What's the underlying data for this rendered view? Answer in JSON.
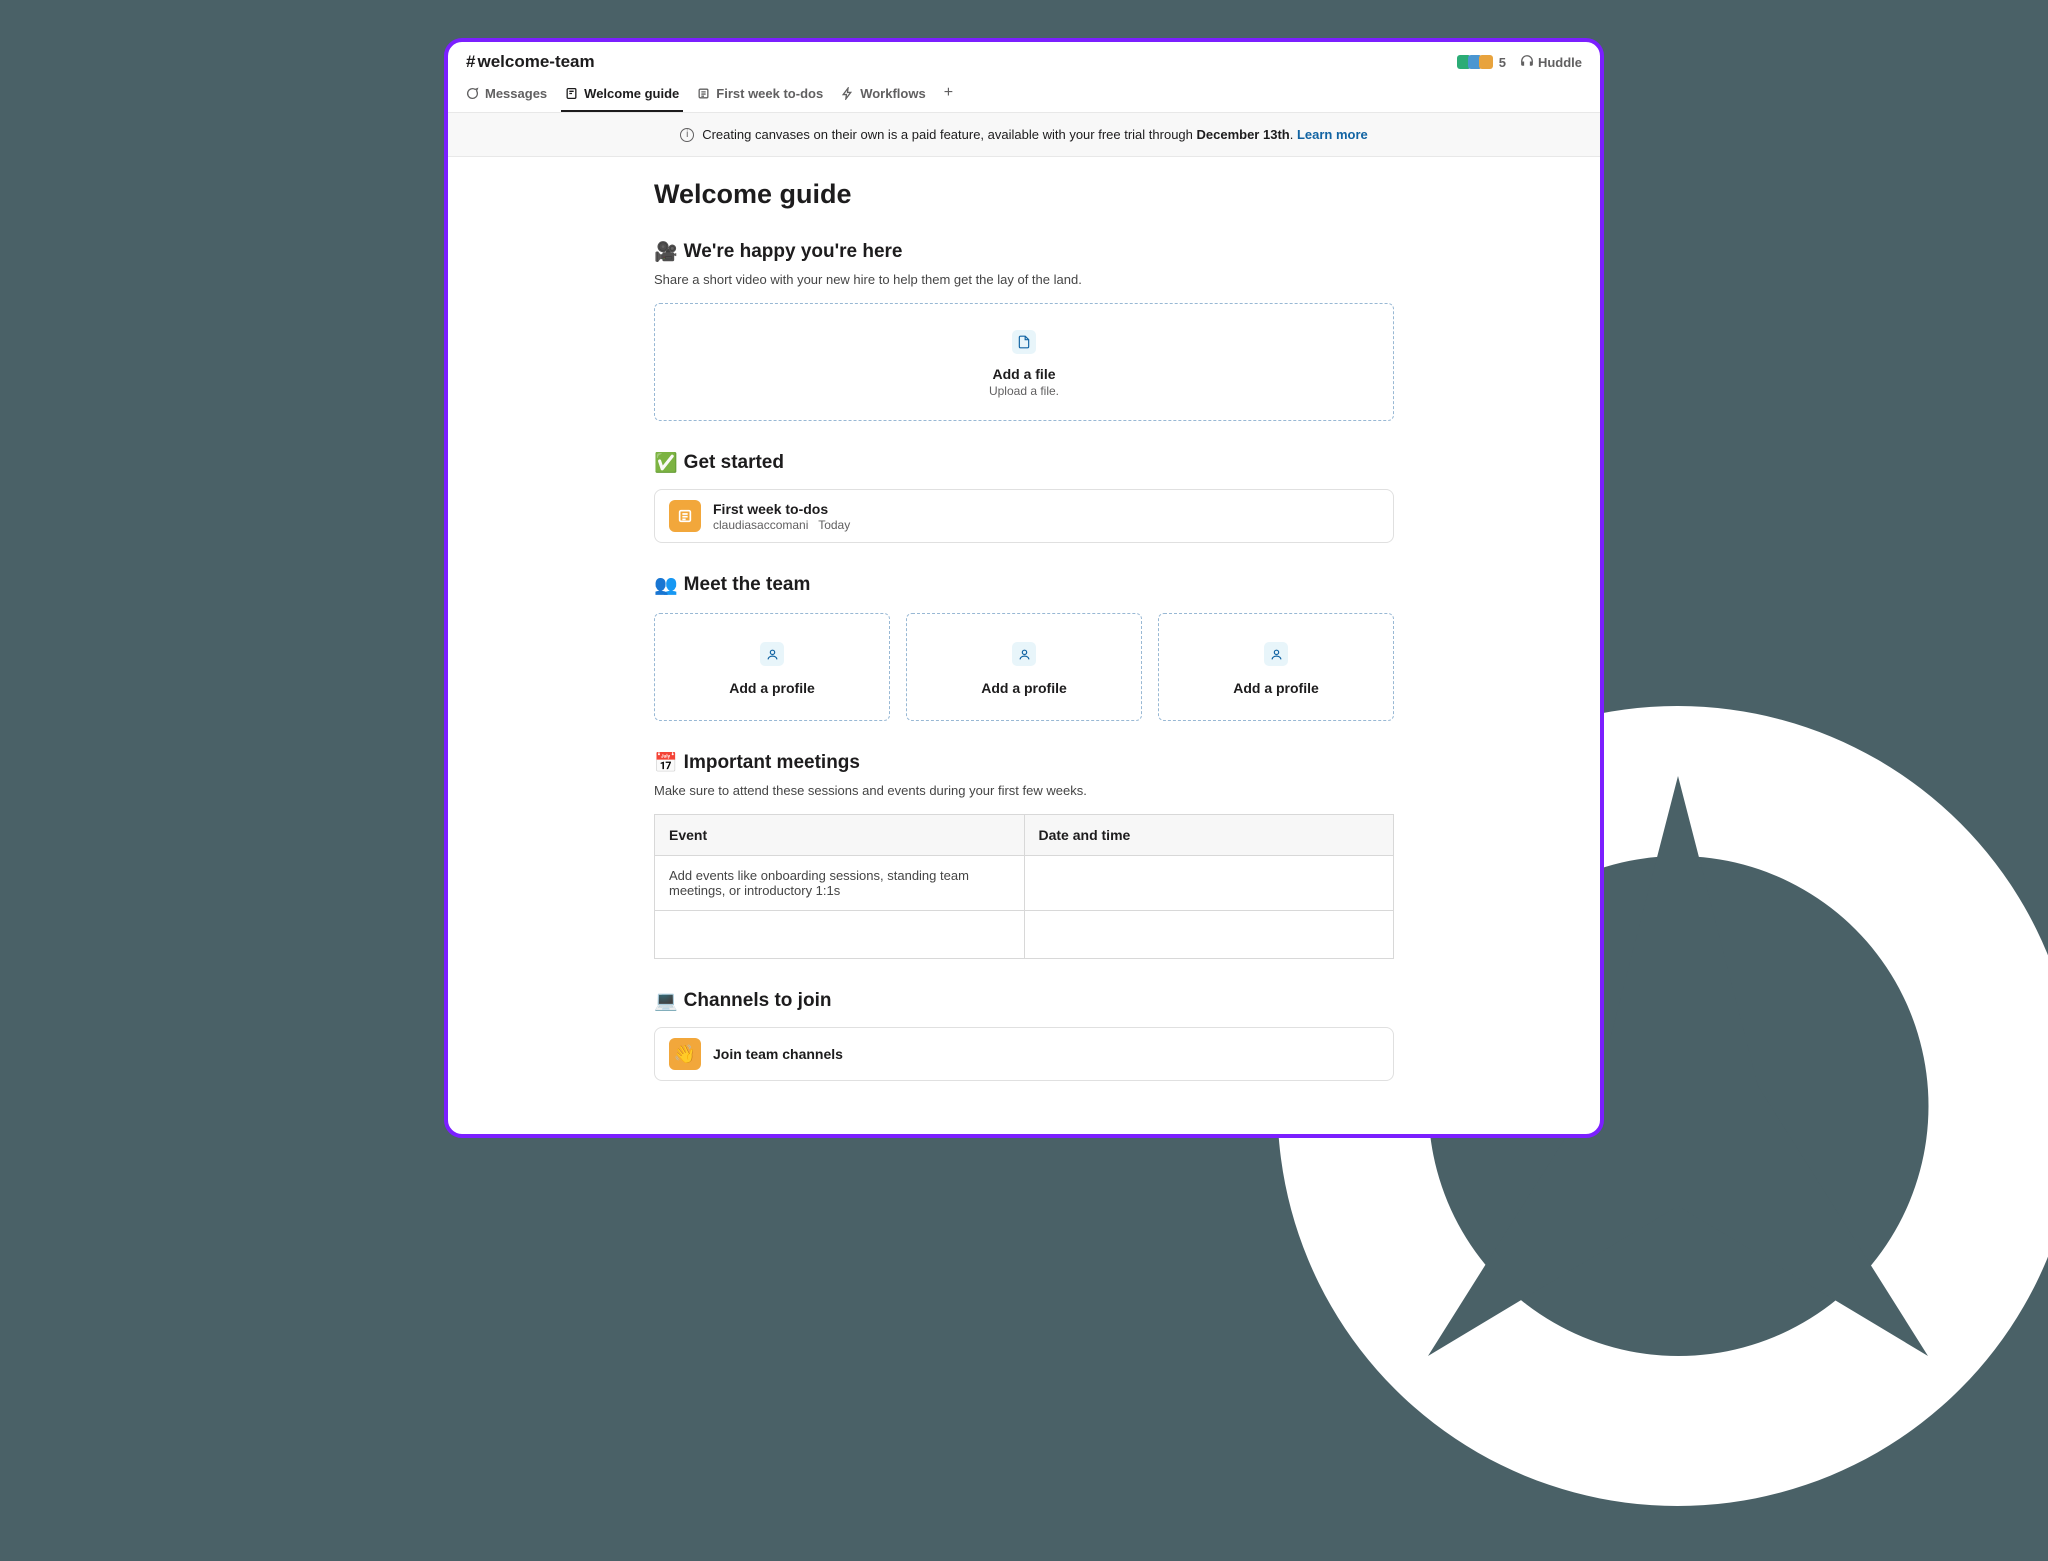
{
  "channel": {
    "hash": "#",
    "name": "welcome-team"
  },
  "header": {
    "member_count": "5",
    "huddle": "Huddle"
  },
  "tabs": {
    "messages": "Messages",
    "welcome_guide": "Welcome guide",
    "first_week": "First week to-dos",
    "workflows": "Workflows"
  },
  "banner": {
    "text": "Creating canvases on their own is a paid feature, available with your free trial through ",
    "date": "December 13th",
    "period": ". ",
    "link": "Learn more"
  },
  "page": {
    "title": "Welcome guide"
  },
  "welcome": {
    "emoji": "🎥",
    "title": "We're happy you're here",
    "desc": "Share a short video with your new hire to help them get the lay of the land.",
    "drop_title": "Add a file",
    "drop_sub": "Upload a file."
  },
  "getstarted": {
    "emoji": "✅",
    "title": "Get started",
    "card_title": "First week to-dos",
    "card_author": "claudiasaccomani",
    "card_date": "Today"
  },
  "meetteam": {
    "emoji": "👥",
    "title": "Meet the team",
    "profile_label": "Add a profile"
  },
  "meetings": {
    "emoji": "📅",
    "title": "Important meetings",
    "desc": "Make sure to attend these sessions and events during your first few weeks.",
    "col1": "Event",
    "col2": "Date and time",
    "row1": "Add events like onboarding sessions, standing team meetings, or introductory 1:1s"
  },
  "channels": {
    "emoji": "💻",
    "title": "Channels to join",
    "card_emoji": "👋",
    "card_title": "Join team channels"
  }
}
